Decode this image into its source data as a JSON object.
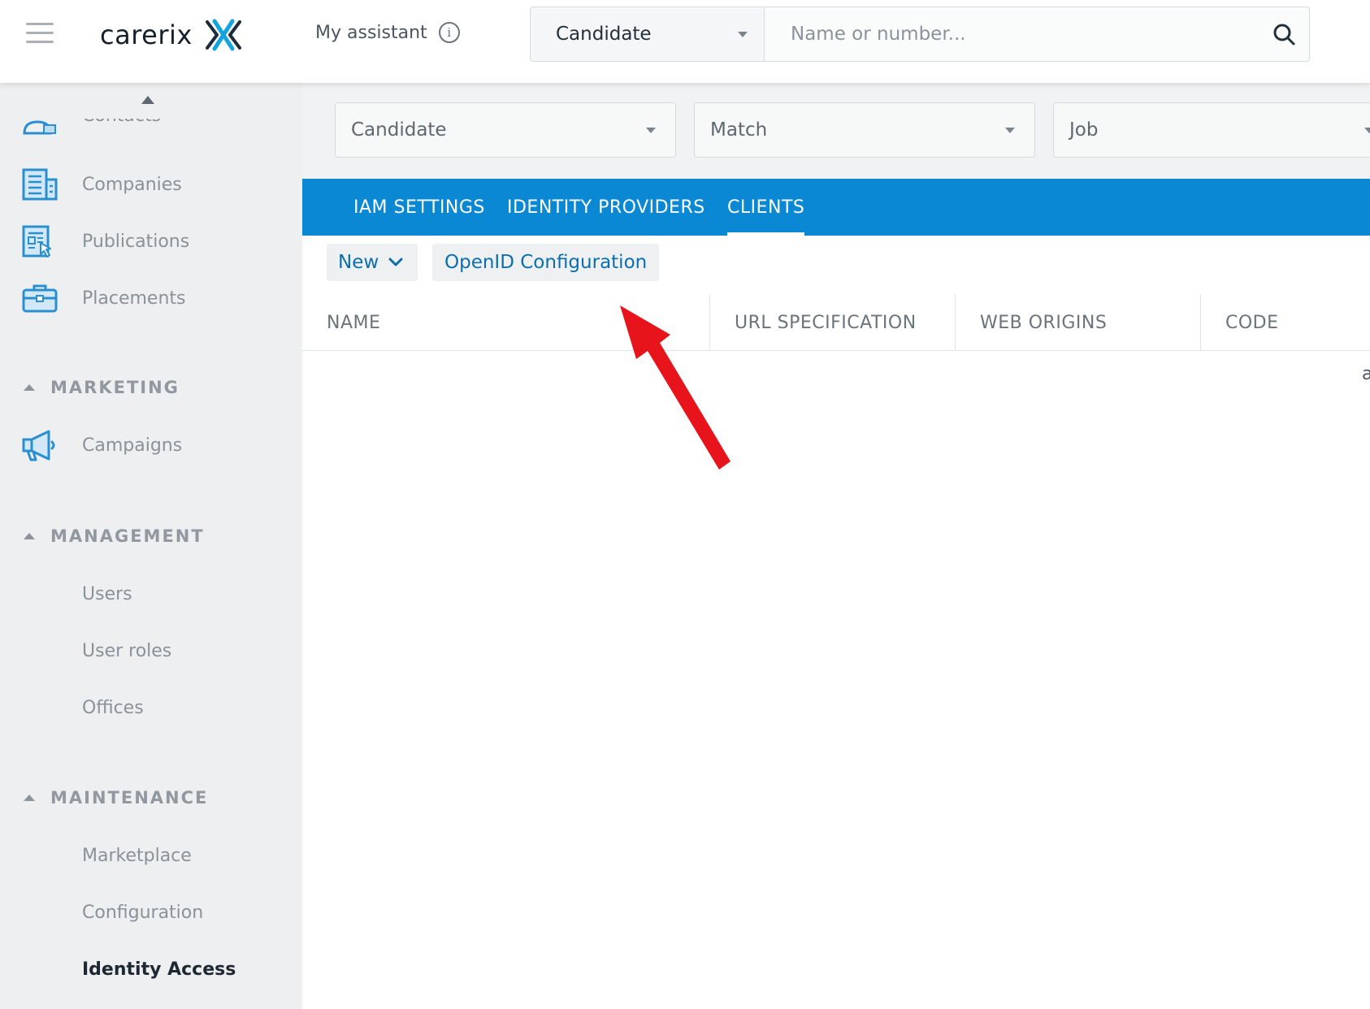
{
  "header": {
    "logo_text": "carerix",
    "assistant_label": "My assistant",
    "search_type": "Candidate",
    "search_placeholder": "Name or number..."
  },
  "sidebar": {
    "partial_item": "Contacts",
    "items_top": [
      {
        "label": "Companies",
        "icon": "companies-icon"
      },
      {
        "label": "Publications",
        "icon": "publications-icon"
      },
      {
        "label": "Placements",
        "icon": "placements-icon"
      }
    ],
    "sections": {
      "marketing": {
        "label": "MARKETING",
        "items": [
          {
            "label": "Campaigns",
            "icon": "megaphone-icon"
          }
        ]
      },
      "management": {
        "label": "MANAGEMENT",
        "items": [
          {
            "label": "Users"
          },
          {
            "label": "User roles"
          },
          {
            "label": "Offices"
          }
        ]
      },
      "maintenance": {
        "label": "MAINTENANCE",
        "items": [
          {
            "label": "Marketplace"
          },
          {
            "label": "Configuration"
          },
          {
            "label": "Identity Access"
          }
        ]
      }
    },
    "active_item": "Identity Access"
  },
  "filters": [
    "Candidate",
    "Match",
    "Job"
  ],
  "tabs": [
    {
      "label": "IAM SETTINGS",
      "active": false
    },
    {
      "label": "IDENTITY PROVIDERS",
      "active": false
    },
    {
      "label": "CLIENTS",
      "active": true
    }
  ],
  "toolbar": {
    "new_label": "New",
    "openid_label": "OpenID Configuration"
  },
  "table": {
    "columns": [
      "NAME",
      "URL SPECIFICATION",
      "WEB ORIGINS",
      "CODE"
    ],
    "row_partial_text": "a"
  },
  "colors": {
    "brand_blue": "#0b88d4",
    "link_blue": "#0b6fad",
    "annotation_red": "#e8141b"
  }
}
